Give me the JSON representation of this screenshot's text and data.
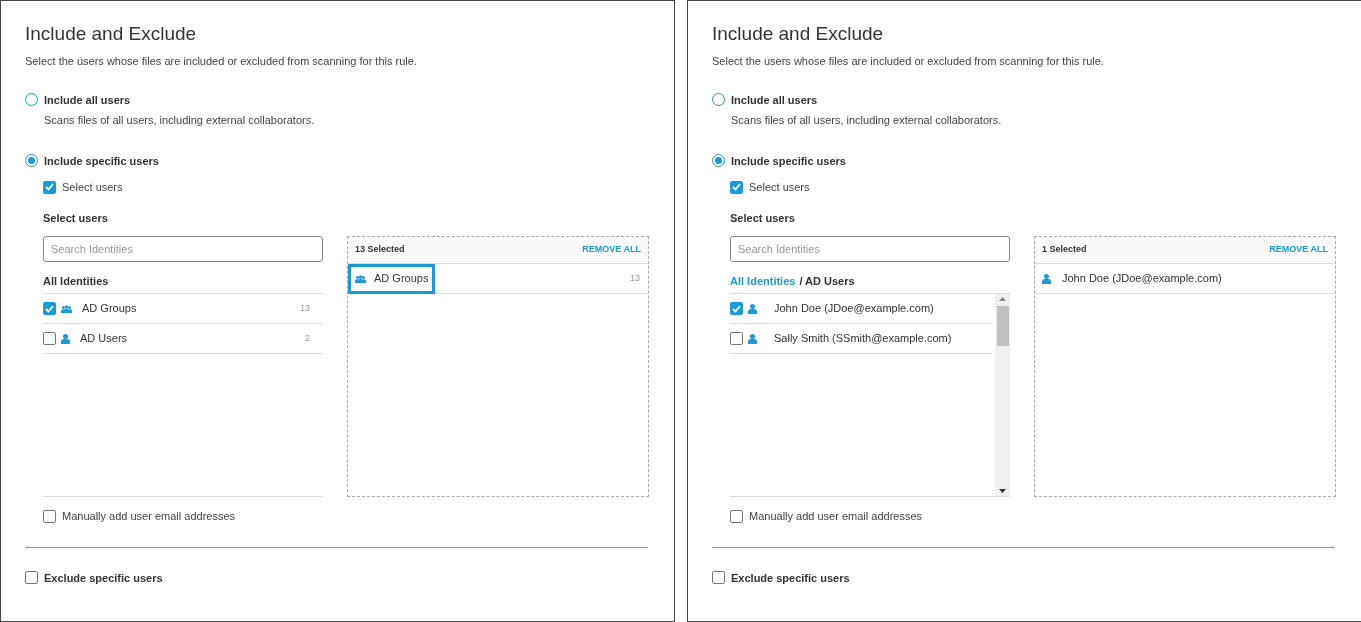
{
  "panels": [
    {
      "title": "Include and Exclude",
      "description": "Select the users whose files are included or excluded from scanning for this rule.",
      "include_all": {
        "label": "Include all users",
        "description": "Scans files of all users, including external collaborators.",
        "selected": false
      },
      "include_specific": {
        "label": "Include specific users",
        "selected": true
      },
      "select_users": {
        "label": "Select users",
        "checked": true
      },
      "section_label": "Select users",
      "search": {
        "placeholder": "Search Identities"
      },
      "breadcrumb": [
        {
          "label": "All Identities",
          "link": false
        }
      ],
      "items": [
        {
          "kind": "group",
          "label": "AD Groups",
          "count": "13",
          "checked": true
        },
        {
          "kind": "user",
          "label": "AD Users",
          "count": "2",
          "checked": false
        }
      ],
      "scrollbar": false,
      "selected_header": {
        "count": "13 Selected",
        "action": "REMOVE ALL"
      },
      "selected_items": [
        {
          "kind": "group",
          "label": "AD Groups",
          "count": "13",
          "focused": true
        }
      ],
      "manual": {
        "label": "Manually add user email addresses",
        "checked": false
      },
      "exclude": {
        "label": "Exclude specific users",
        "checked": false
      }
    },
    {
      "title": "Include and Exclude",
      "description": "Select the users whose files are included or excluded from scanning for this rule.",
      "include_all": {
        "label": "Include all users",
        "description": "Scans files of all users, including external collaborators.",
        "selected": false
      },
      "include_specific": {
        "label": "Include specific users",
        "selected": true
      },
      "select_users": {
        "label": "Select users",
        "checked": true
      },
      "section_label": "Select users",
      "search": {
        "placeholder": "Search Identities"
      },
      "breadcrumb": [
        {
          "label": "All Identities",
          "link": true
        },
        {
          "label": "/ AD Users",
          "link": false
        }
      ],
      "items": [
        {
          "kind": "user",
          "label": "John Doe (JDoe@example.com)",
          "checked": true
        },
        {
          "kind": "user",
          "label": "Sally Smith (SSmith@example.com)",
          "checked": false
        }
      ],
      "scrollbar": true,
      "selected_header": {
        "count": "1 Selected",
        "action": "REMOVE ALL"
      },
      "selected_items": [
        {
          "kind": "user",
          "label": "John Doe (JDoe@example.com)",
          "focused": false
        }
      ],
      "manual": {
        "label": "Manually add user email addresses",
        "checked": false
      },
      "exclude": {
        "label": "Exclude specific users",
        "checked": false
      }
    }
  ]
}
